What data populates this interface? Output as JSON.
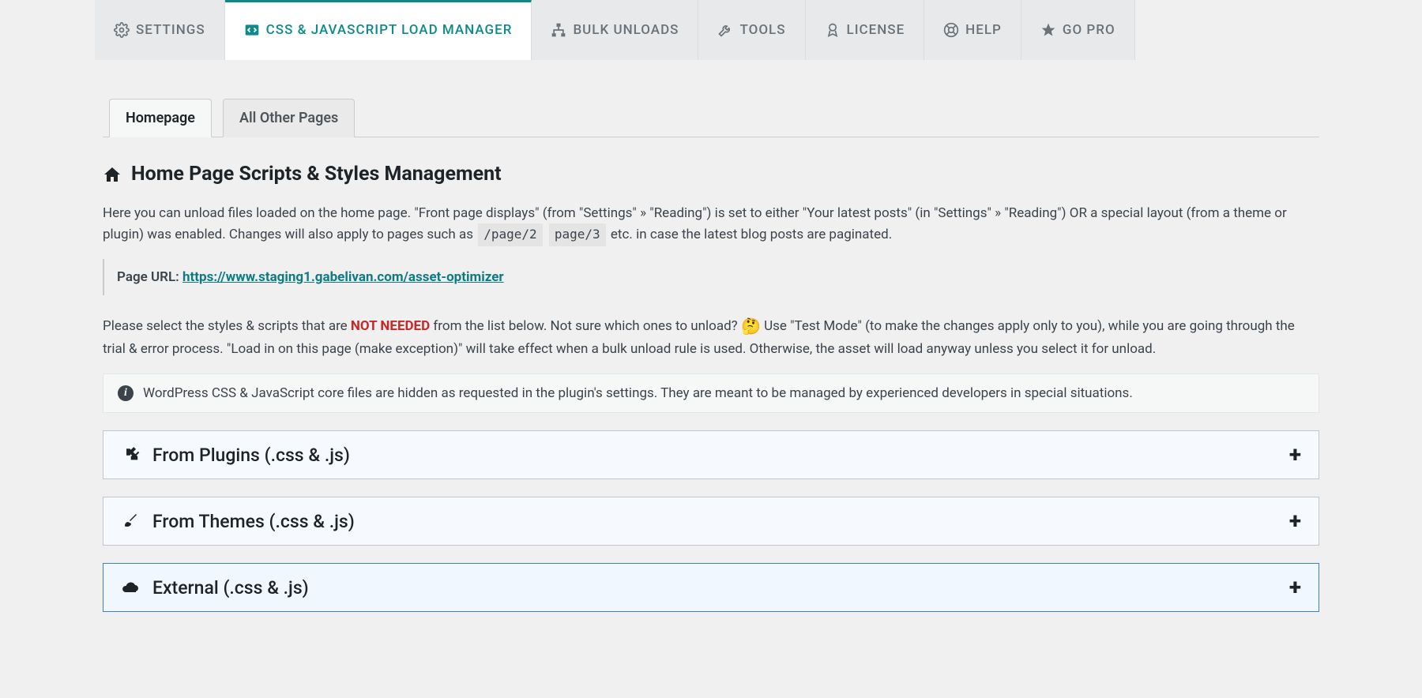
{
  "main_tabs": {
    "settings": "SETTINGS",
    "css_js": "CSS & JAVASCRIPT LOAD MANAGER",
    "bulk": "BULK UNLOADS",
    "tools": "TOOLS",
    "license": "LICENSE",
    "help": "HELP",
    "gopro": "GO PRO"
  },
  "sub_tabs": {
    "homepage": "Homepage",
    "all_other": "All Other Pages"
  },
  "heading": "Home Page Scripts & Styles Management",
  "intro": {
    "part1": "Here you can unload files loaded on the home page. \"Front page displays\" (from \"Settings\" » \"Reading\") is set to either \"Your latest posts\" (in \"Settings\" » \"Reading\") OR a special layout (from a theme or plugin) was enabled. Changes will also apply to pages such as ",
    "code1": "/page/2",
    "code2": "page/3",
    "part2": " etc. in case the latest blog posts are paginated."
  },
  "url_label": "Page URL: ",
  "url_value": "https://www.staging1.gabelivan.com/asset-optimizer",
  "select_para": {
    "p1": "Please select the styles & scripts that are ",
    "not_needed": "NOT NEEDED",
    "p2": " from the list below. Not sure which ones to unload? ",
    "emoji": "🤔",
    "p3": " Use \"Test Mode\" (to make the changes apply only to you), while you are going through the trial & error process. \"Load in on this page (make exception)\" will take effect when a bulk unload rule is used. Otherwise, the asset will load anyway unless you select it for unload."
  },
  "info_notice": "WordPress CSS & JavaScript core files are hidden as requested in the plugin's settings. They are meant to be managed by experienced developers in special situations.",
  "accordions": {
    "plugins": "From Plugins (.css & .js)",
    "themes": "From Themes (.css & .js)",
    "external": "External (.css & .js)"
  }
}
